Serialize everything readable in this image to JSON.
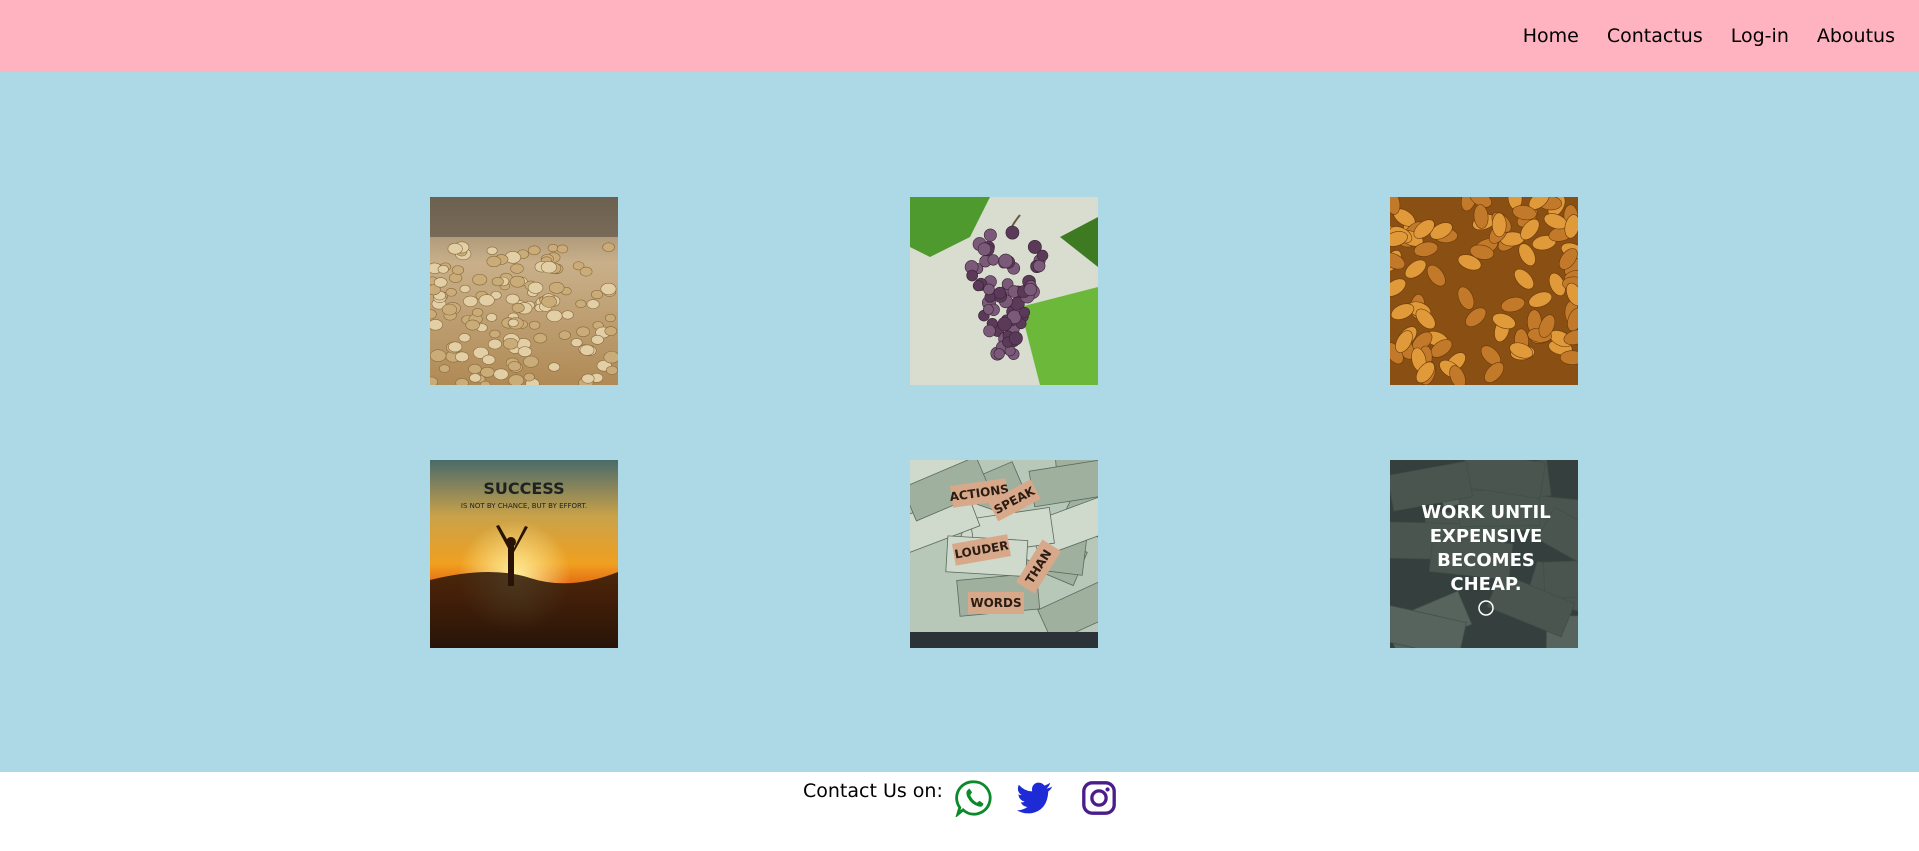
{
  "nav": {
    "items": [
      {
        "label": "Home"
      },
      {
        "label": "Contactus"
      },
      {
        "label": "Log-in"
      },
      {
        "label": "Aboutus"
      }
    ]
  },
  "gallery": {
    "tiles": [
      {
        "subject": "pistachios"
      },
      {
        "subject": "grapes"
      },
      {
        "subject": "almonds"
      },
      {
        "subject": "success-quote",
        "text_line1": "SUCCESS",
        "text_line2": "IS NOT BY CHANCE, BUT BY EFFORT."
      },
      {
        "subject": "actions-quote",
        "words": [
          "ACTIONS",
          "SPEAK",
          "LOUDER",
          "THAN",
          "WORDS"
        ]
      },
      {
        "subject": "work-quote",
        "lines": [
          "WORK UNTIL",
          "EXPENSIVE",
          "BECOMES",
          "CHEAP."
        ]
      }
    ]
  },
  "footer": {
    "contact_label": "Contact Us on:",
    "icons": [
      "whatsapp-icon",
      "twitter-icon",
      "instagram-icon"
    ]
  },
  "colors": {
    "navbar": "#ffb3c1",
    "main": "#add8e6",
    "whatsapp": "#0a8a2a",
    "twitter": "#1d2bd6",
    "instagram": "#4b1d8a"
  }
}
